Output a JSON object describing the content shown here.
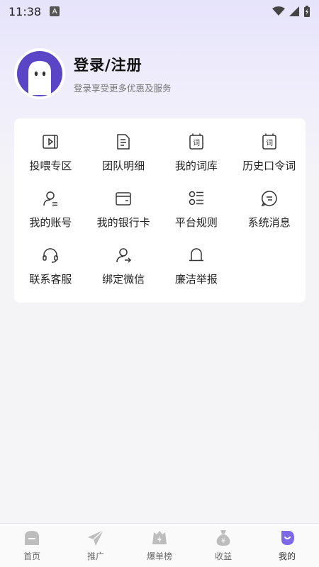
{
  "status_bar": {
    "time": "11:38",
    "notification_letter": "A"
  },
  "profile": {
    "title": "登录/注册",
    "subtitle": "登录享受更多优惠及服务"
  },
  "menu": {
    "items": [
      {
        "label": "投喂专区",
        "icon": "video-icon"
      },
      {
        "label": "团队明细",
        "icon": "document-icon"
      },
      {
        "label": "我的词库",
        "icon": "word-book-icon"
      },
      {
        "label": "历史口令词",
        "icon": "word-history-icon"
      },
      {
        "label": "我的账号",
        "icon": "user-account-icon"
      },
      {
        "label": "我的银行卡",
        "icon": "bank-card-icon"
      },
      {
        "label": "平台规则",
        "icon": "rules-list-icon"
      },
      {
        "label": "系统消息",
        "icon": "message-icon"
      },
      {
        "label": "联系客服",
        "icon": "headset-icon"
      },
      {
        "label": "绑定微信",
        "icon": "bind-user-icon"
      },
      {
        "label": "廉洁举报",
        "icon": "bell-icon"
      }
    ]
  },
  "tabbar": {
    "tabs": [
      {
        "label": "首页",
        "icon": "home-icon"
      },
      {
        "label": "推广",
        "icon": "send-icon"
      },
      {
        "label": "爆单榜",
        "icon": "ranking-icon"
      },
      {
        "label": "收益",
        "icon": "money-bag-icon"
      },
      {
        "label": "我的",
        "icon": "profile-icon",
        "active": true
      }
    ]
  },
  "colors": {
    "accent": "#5b45c7",
    "icon_stroke": "#333333",
    "tab_icon_inactive": "#bdbdbd"
  }
}
